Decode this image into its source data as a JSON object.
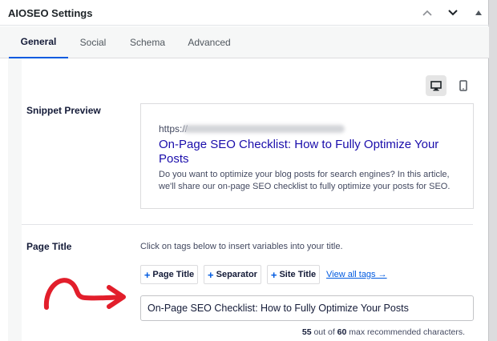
{
  "panel": {
    "title": "AIOSEO Settings",
    "controls": [
      "chevron-up",
      "chevron-down",
      "collapse-toggle"
    ]
  },
  "tabs": [
    {
      "label": "General",
      "active": true
    },
    {
      "label": "Social",
      "active": false
    },
    {
      "label": "Schema",
      "active": false
    },
    {
      "label": "Advanced",
      "active": false
    }
  ],
  "preview_devices": [
    {
      "name": "desktop",
      "active": true
    },
    {
      "name": "mobile",
      "active": false
    }
  ],
  "snippet_preview": {
    "label": "Snippet Preview",
    "url_prefix": "https://",
    "title": "On-Page SEO Checklist: How to Fully Optimize Your Posts",
    "description": "Do you want to optimize your blog posts for search engines? In this article, we'll share our on-page SEO checklist to fully optimize your posts for SEO."
  },
  "page_title": {
    "label": "Page Title",
    "helper": "Click on tags below to insert variables into your title.",
    "tags": [
      "Page Title",
      "Separator",
      "Site Title"
    ],
    "view_all": "View all tags →",
    "value": "On-Page SEO Checklist: How to Fully Optimize Your Posts",
    "char_count": "55",
    "char_max": "60",
    "count_text_1": " out of ",
    "count_text_2": " max recommended characters."
  },
  "colors": {
    "accent": "#005ae0",
    "link_title": "#1a0dab",
    "arrow": "#e21e2b"
  }
}
